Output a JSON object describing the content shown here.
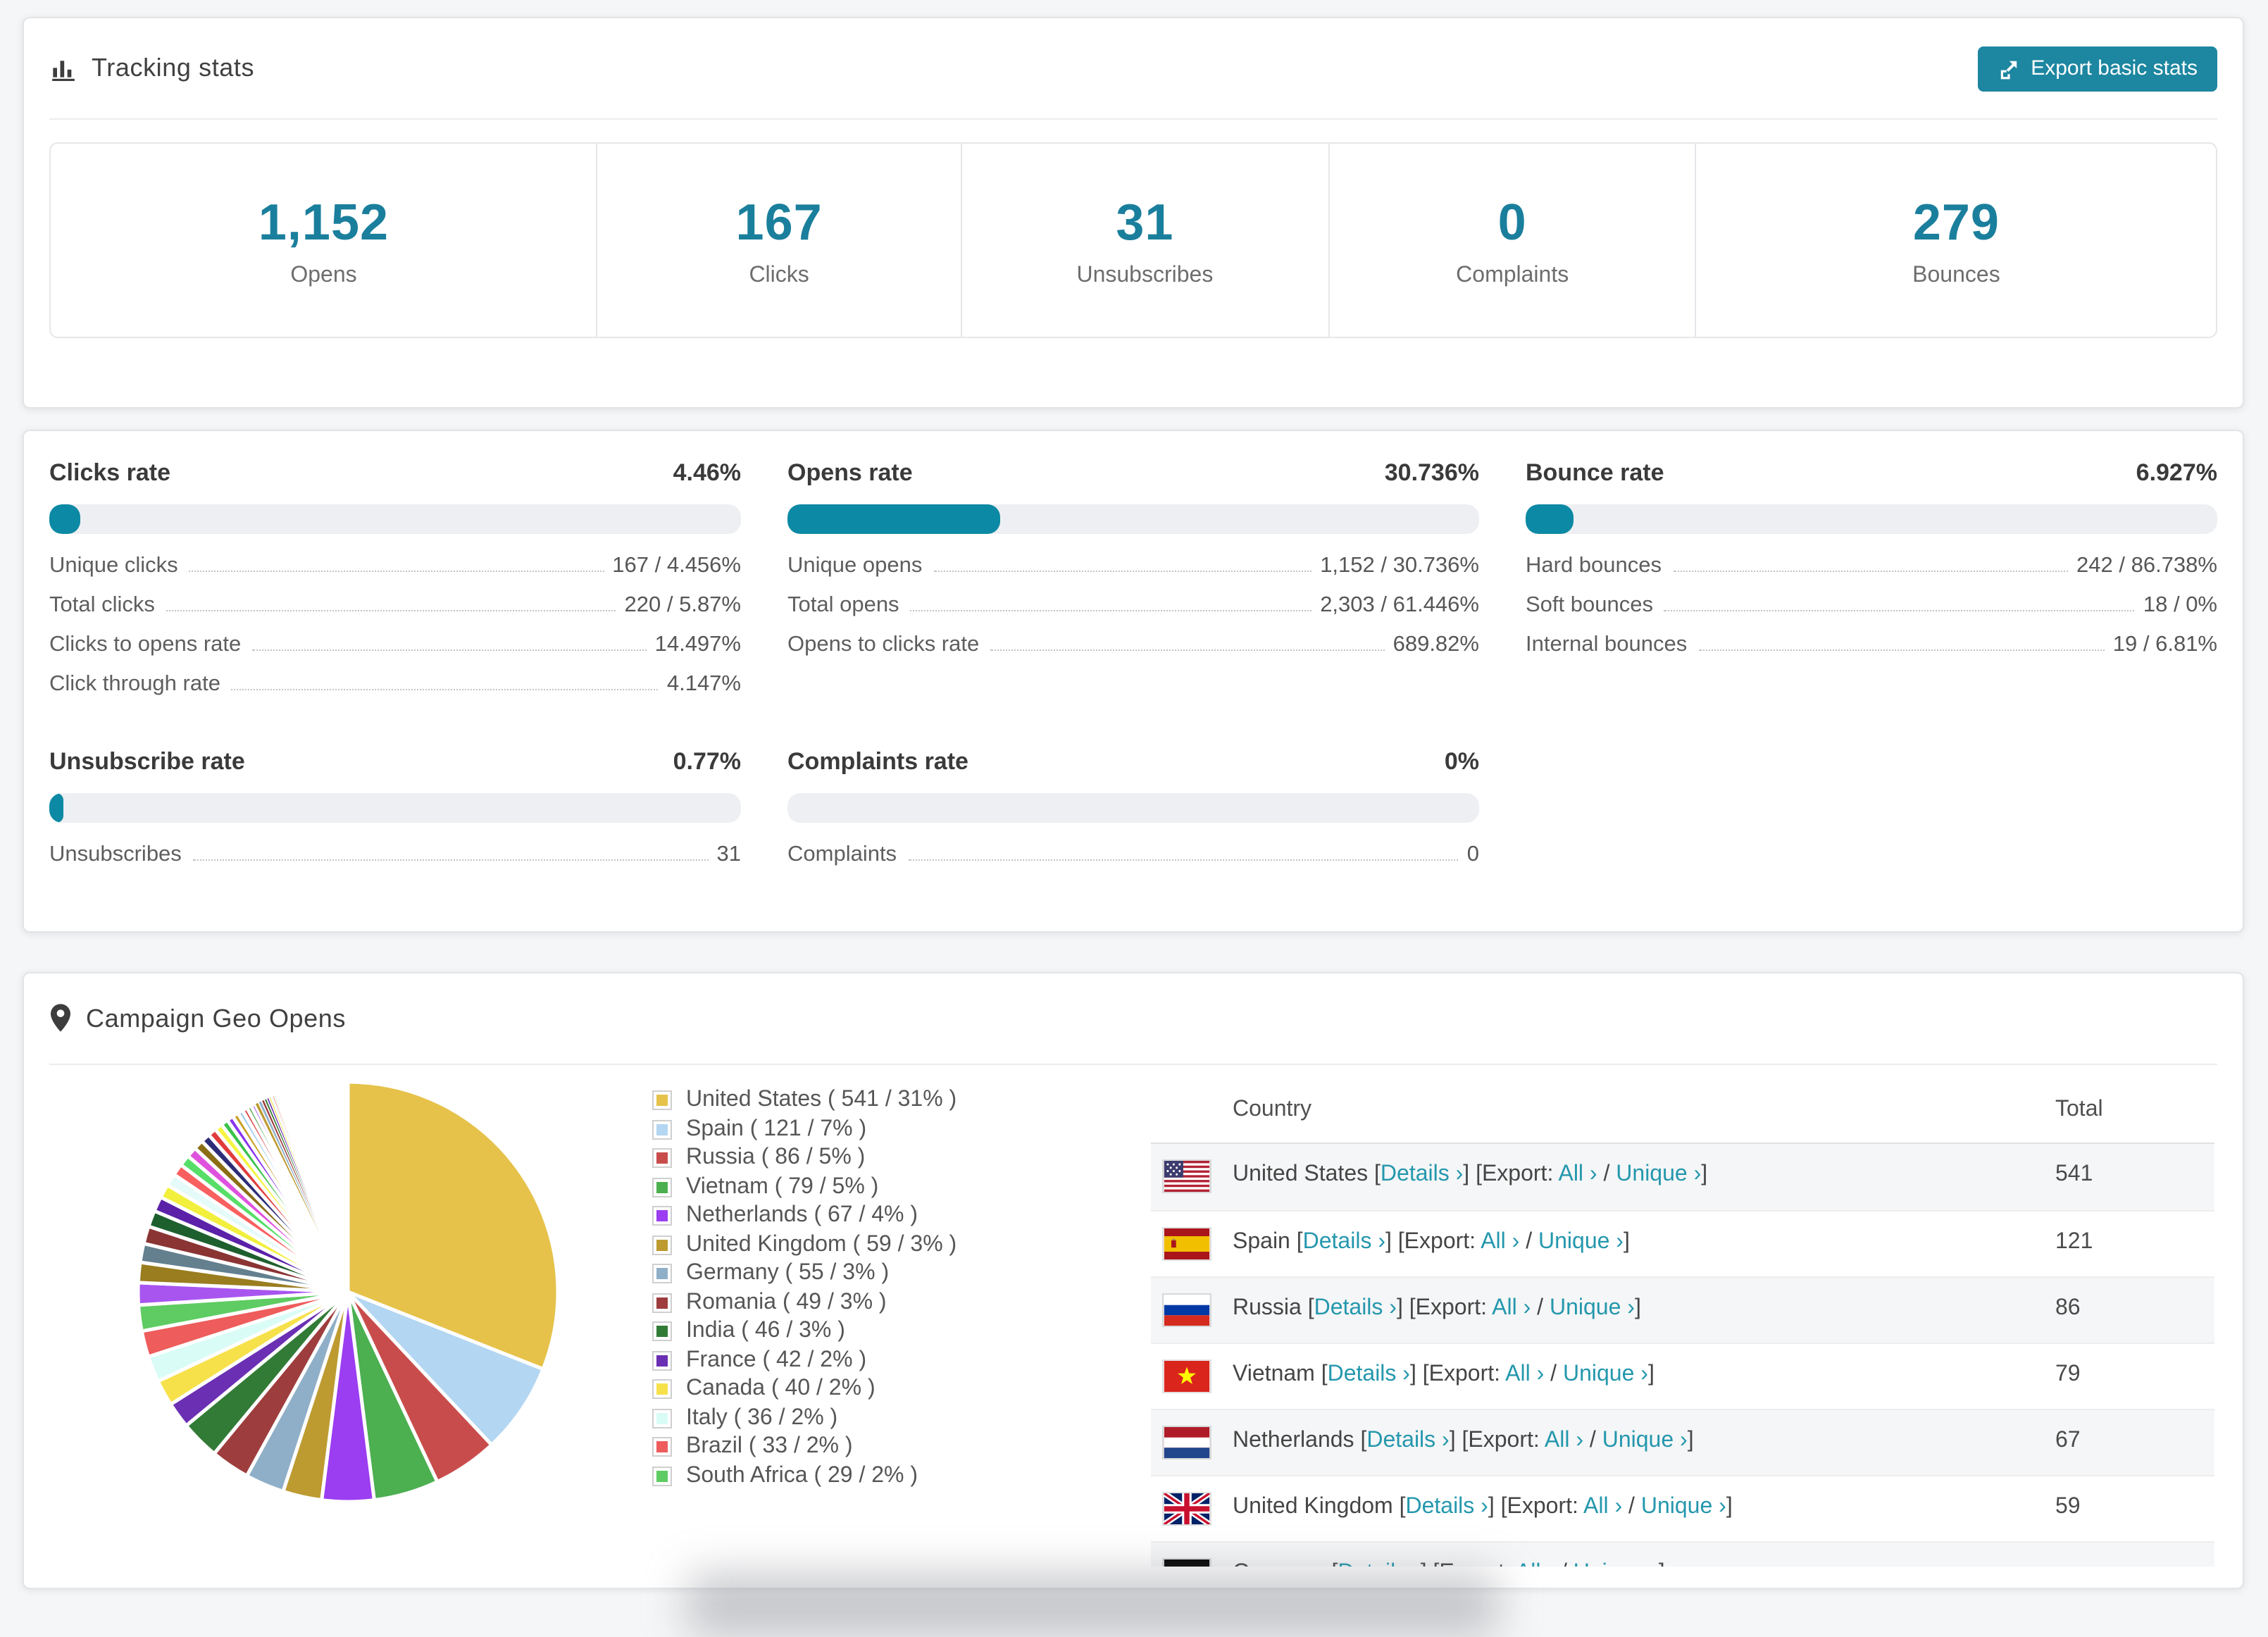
{
  "colors": {
    "accent": "#1a7f9c",
    "button": "#1d86a0",
    "bar_fill": "#0c89a4",
    "link": "#2497ad"
  },
  "tracking": {
    "title": "Tracking stats",
    "export_button": "Export basic stats",
    "stats": [
      {
        "value": "1,152",
        "label": "Opens"
      },
      {
        "value": "167",
        "label": "Clicks"
      },
      {
        "value": "31",
        "label": "Unsubscribes"
      },
      {
        "value": "0",
        "label": "Complaints"
      },
      {
        "value": "279",
        "label": "Bounces"
      }
    ]
  },
  "rates": {
    "blocks": [
      {
        "title": "Clicks rate",
        "value": "4.46%",
        "percent": 4.46,
        "rows": [
          {
            "label": "Unique clicks",
            "value": "167 / 4.456%"
          },
          {
            "label": "Total clicks",
            "value": "220 / 5.87%"
          },
          {
            "label": "Clicks to opens rate",
            "value": "14.497%"
          },
          {
            "label": "Click through rate",
            "value": "4.147%"
          }
        ]
      },
      {
        "title": "Opens rate",
        "value": "30.736%",
        "percent": 30.736,
        "rows": [
          {
            "label": "Unique opens",
            "value": "1,152 / 30.736%"
          },
          {
            "label": "Total opens",
            "value": "2,303 / 61.446%"
          },
          {
            "label": "Opens to clicks rate",
            "value": "689.82%"
          }
        ]
      },
      {
        "title": "Bounce rate",
        "value": "6.927%",
        "percent": 6.927,
        "rows": [
          {
            "label": "Hard bounces",
            "value": "242 / 86.738%"
          },
          {
            "label": "Soft bounces",
            "value": "18 / 0%"
          },
          {
            "label": "Internal bounces",
            "value": "19 / 6.81%"
          }
        ]
      },
      {
        "title": "Unsubscribe rate",
        "value": "0.77%",
        "percent": 0.77,
        "rows": [
          {
            "label": "Unsubscribes",
            "value": "31"
          }
        ]
      },
      {
        "title": "Complaints rate",
        "value": "0%",
        "percent": 0,
        "rows": [
          {
            "label": "Complaints",
            "value": "0"
          }
        ]
      }
    ]
  },
  "geo": {
    "title": "Campaign Geo Opens",
    "table": {
      "headers": [
        "Country",
        "Total"
      ],
      "links": {
        "details": "Details",
        "export": "Export:",
        "all": "All",
        "unique": "Unique"
      },
      "rows": [
        {
          "country": "United States",
          "flag": "us",
          "total": "541"
        },
        {
          "country": "Spain",
          "flag": "es",
          "total": "121"
        },
        {
          "country": "Russia",
          "flag": "ru",
          "total": "86"
        },
        {
          "country": "Vietnam",
          "flag": "vn",
          "total": "79"
        },
        {
          "country": "Netherlands",
          "flag": "nl",
          "total": "67"
        },
        {
          "country": "United Kingdom",
          "flag": "gb",
          "total": "59"
        },
        {
          "country": "Germany",
          "flag": "de",
          "total": ""
        }
      ]
    }
  },
  "chart_data": {
    "type": "pie",
    "title": "Campaign Geo Opens",
    "legend_position": "right",
    "start_angle_deg": -90,
    "direction": "clockwise",
    "slices": [
      {
        "label": "United States",
        "value": 541,
        "pct": 31,
        "color": "#e6c24a"
      },
      {
        "label": "Spain",
        "value": 121,
        "pct": 7,
        "color": "#b3d6f2"
      },
      {
        "label": "Russia",
        "value": 86,
        "pct": 5,
        "color": "#c94c4c"
      },
      {
        "label": "Vietnam",
        "value": 79,
        "pct": 5,
        "color": "#4caf50"
      },
      {
        "label": "Netherlands",
        "value": 67,
        "pct": 4,
        "color": "#9b3df0"
      },
      {
        "label": "United Kingdom",
        "value": 59,
        "pct": 3,
        "color": "#bd9b31"
      },
      {
        "label": "Germany",
        "value": 55,
        "pct": 3,
        "color": "#8fafc8"
      },
      {
        "label": "Romania",
        "value": 49,
        "pct": 3,
        "color": "#9e3d3d"
      },
      {
        "label": "India",
        "value": 46,
        "pct": 3,
        "color": "#327b36"
      },
      {
        "label": "France",
        "value": 42,
        "pct": 2,
        "color": "#6b2fb3"
      },
      {
        "label": "Canada",
        "value": 40,
        "pct": 2,
        "color": "#f7e14b"
      },
      {
        "label": "Italy",
        "value": 36,
        "pct": 2,
        "color": "#d9fcf6"
      },
      {
        "label": "Brazil",
        "value": 33,
        "pct": 2,
        "color": "#ee5c5c"
      },
      {
        "label": "South Africa",
        "value": 29,
        "pct": 2,
        "color": "#5ecc62"
      }
    ],
    "others": {
      "label": "other countries (unlabeled small slices)",
      "values": [
        1.7,
        1.55,
        1.45,
        1.35,
        1.25,
        1.15,
        1.05,
        0.95,
        0.9,
        0.85,
        0.8,
        0.75,
        0.7,
        0.65,
        0.6,
        0.55,
        0.5,
        0.46,
        0.42,
        0.38,
        0.35,
        0.32,
        0.29,
        0.26,
        0.23,
        0.2,
        0.18,
        0.16,
        0.14,
        0.12,
        0.1,
        0.09,
        0.08,
        0.07,
        0.06,
        0.05,
        0.05,
        0.04,
        0.04,
        0.03,
        0.03,
        0.03,
        0.02,
        0.02
      ],
      "colors": [
        "#a855f0",
        "#9a7d1f",
        "#64808f",
        "#8a3434",
        "#1e5f2e",
        "#5b21a8",
        "#f2ef3d",
        "#e4fbf9",
        "#f86060",
        "#57de69",
        "#de52de",
        "#8a6d14",
        "#2c2c78",
        "#e03c3c",
        "#f5f542",
        "#39c24a",
        "#8833ee",
        "#c9a227",
        "#a8d0f0",
        "#d94848",
        "#4aa54e",
        "#9933ee",
        "#bd9b31",
        "#8fafc8",
        "#9e3d3d",
        "#327b36",
        "#6b2fb3",
        "#f7e14b",
        "#d9fcf6",
        "#ee5c5c",
        "#5ecc62",
        "#e44fe0",
        "#2a2a6e",
        "#44b39b",
        "#c06cf0",
        "#7c2d2d",
        "#e03c3c",
        "#39c24a",
        "#8833ee",
        "#c9a227",
        "#64808f",
        "#f86060",
        "#2a2a6e",
        "#57de69"
      ]
    }
  }
}
